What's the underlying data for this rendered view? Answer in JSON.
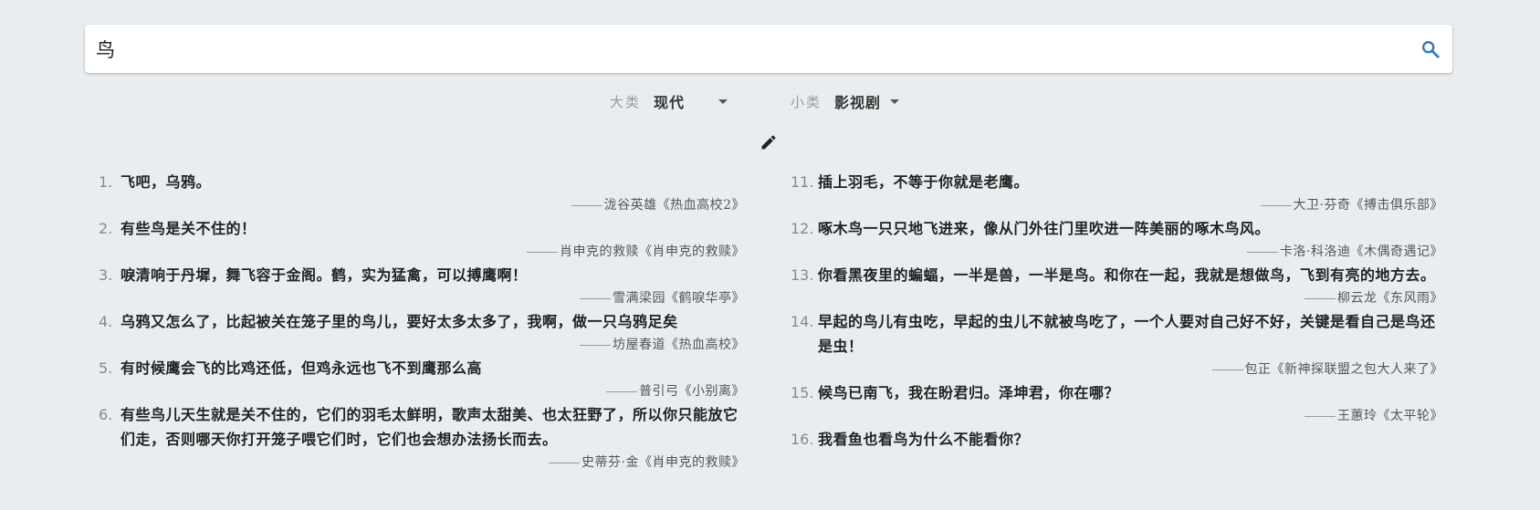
{
  "search": {
    "value": "鸟"
  },
  "filters": {
    "category": {
      "label": "大类",
      "value": "现代"
    },
    "subcategory": {
      "label": "小类",
      "value": "影视剧"
    }
  },
  "quotes_left": [
    {
      "num": "1.",
      "text": "飞吧，乌鸦。",
      "source": "泷谷英雄《热血高校2》"
    },
    {
      "num": "2.",
      "text": "有些鸟是关不住的！",
      "source": "肖申克的救赎《肖申克的救赎》"
    },
    {
      "num": "3.",
      "text": "唳清响于丹墀，舞飞容于金阁。鹤，实为猛禽，可以搏鹰啊！",
      "source": "雪满梁园《鹤唳华亭》"
    },
    {
      "num": "4.",
      "text": "乌鸦又怎么了，比起被关在笼子里的鸟儿，要好太多太多了，我啊，做一只乌鸦足矣",
      "source": "坊屋春道《热血高校》"
    },
    {
      "num": "5.",
      "text": "有时候鹰会飞的比鸡还低，但鸡永远也飞不到鹰那么高",
      "source": "普引弓《小别离》"
    },
    {
      "num": "6.",
      "text": "有些鸟儿天生就是关不住的，它们的羽毛太鲜明，歌声太甜美、也太狂野了，所以你只能放它们走，否则哪天你打开笼子喂它们时，它们也会想办法扬长而去。",
      "source": "史蒂芬·金《肖申克的救赎》"
    }
  ],
  "quotes_right": [
    {
      "num": "11.",
      "text": "插上羽毛，不等于你就是老鹰。",
      "source": "大卫·芬奇《搏击俱乐部》"
    },
    {
      "num": "12.",
      "text": "啄木鸟一只只地飞进来，像从门外往门里吹进一阵美丽的啄木鸟风。",
      "source": "卡洛·科洛迪《木偶奇遇记》"
    },
    {
      "num": "13.",
      "text": "你看黑夜里的蝙蝠，一半是兽，一半是鸟。和你在一起，我就是想做鸟，飞到有亮的地方去。",
      "source": "柳云龙《东风雨》"
    },
    {
      "num": "14.",
      "text": "早起的鸟儿有虫吃，早起的虫儿不就被鸟吃了，一个人要对自己好不好，关键是看自己是鸟还是虫！",
      "source": "包正《新神探联盟之包大人来了》"
    },
    {
      "num": "15.",
      "text": "候鸟已南飞，我在盼君归。泽坤君，你在哪？",
      "source": "王蕙玲《太平轮》"
    },
    {
      "num": "16.",
      "text": "我看鱼也看鸟为什么不能看你？",
      "source": ""
    }
  ]
}
